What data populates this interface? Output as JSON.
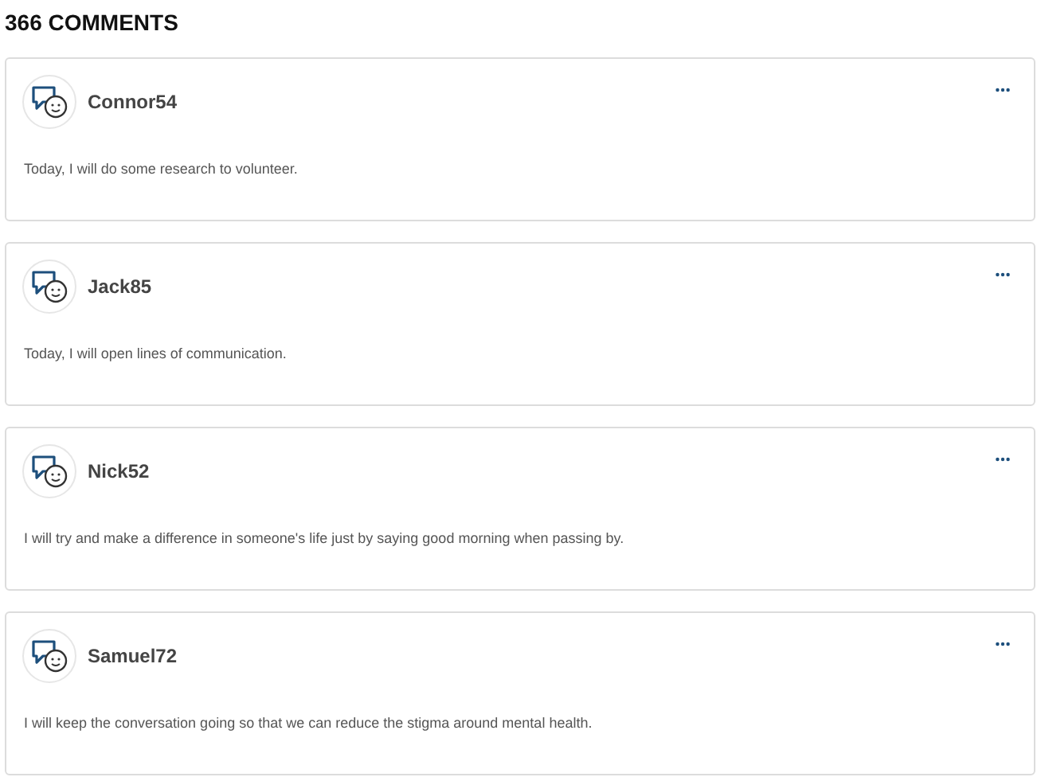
{
  "heading": "366 COMMENTS",
  "comments": [
    {
      "author": "Connor54",
      "text": "Today, I will do some research to volunteer."
    },
    {
      "author": "Jack85",
      "text": "Today, I will open lines of communication."
    },
    {
      "author": "Nick52",
      "text": "I will try and make a difference in someone's life just by saying good morning when passing by."
    },
    {
      "author": "Samuel72",
      "text": "I will keep the conversation going so that we can reduce the stigma around mental health."
    }
  ]
}
